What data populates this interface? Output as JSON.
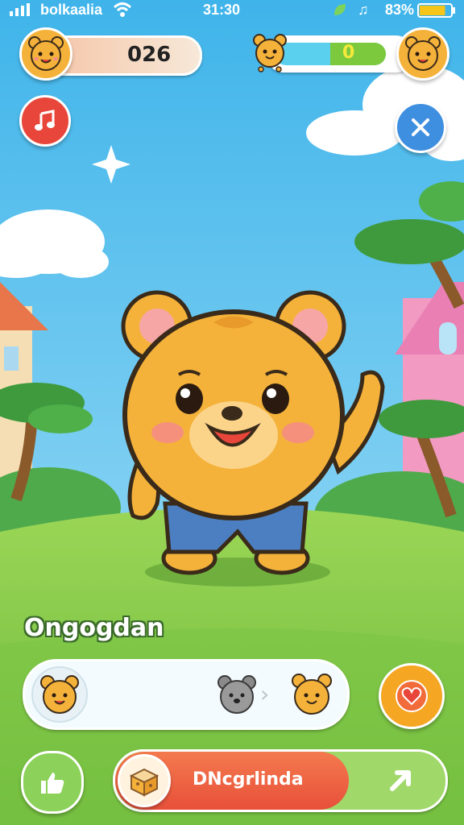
{
  "status_bar": {
    "carrier": "bolkaalia",
    "time": "31:30",
    "battery": "83%",
    "battery_fill": 0.83
  },
  "hud": {
    "score": "026",
    "progress_value": "0",
    "progress_fill": 0.5
  },
  "scene": {
    "name_label": "Ongogdan"
  },
  "evolution_bar": {
    "stage_icons": [
      "bear-cub-icon",
      "gray-bear-icon",
      "golden-bear-icon"
    ]
  },
  "bottom_bar": {
    "action_label": "DNcgrlinda"
  },
  "colors": {
    "sky": "#5fc3ee",
    "grass": "#86cc4a",
    "bear": "#f4b23a",
    "music_button": "#e8463a",
    "close_button": "#3f8fe0",
    "action_button": "#ee5f3c",
    "heart_button": "#f5a623",
    "like_button": "#8cd15a"
  }
}
